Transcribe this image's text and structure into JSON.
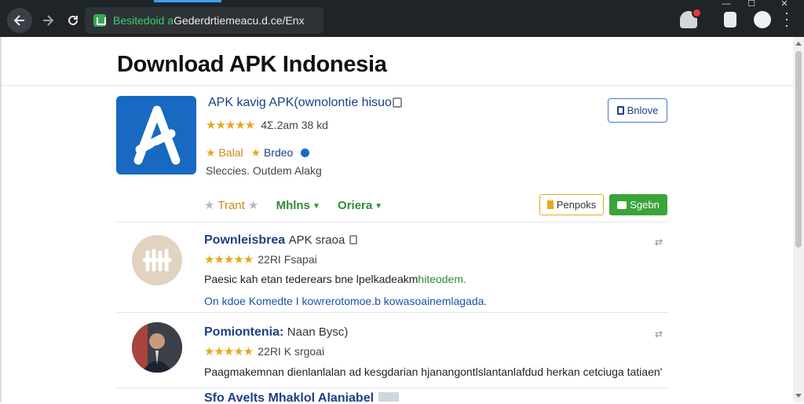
{
  "browser": {
    "url_host": "Besitedoid a",
    "url_path": "Gederdrtiemeacu.d.ce/Enx",
    "window_controls": [
      "—",
      "☐",
      "✕"
    ]
  },
  "page": {
    "title": "Download APK Indonesia"
  },
  "app": {
    "name": "APK kavig APK(ownolontie hisuo",
    "stars": "★★★★★",
    "meta": "4Σ.2am 38 kd",
    "tag1": "Balal",
    "tag2": "Brdeo",
    "categories": "Sleccies. Outdem Alakg",
    "follow_label": "Bnlove"
  },
  "filters": {
    "trending": "Trant",
    "mhins": "Mhlns",
    "oriera": "Oriera",
    "report_label": "Penpoks",
    "sign_label": "Sgebn"
  },
  "reviews": [
    {
      "name": "Pownleisbrea",
      "suffix": "APK sraoa",
      "stars": "★★★★★",
      "meta": "22RI Fsapai",
      "text_main": "Paesic kah etan tederears bne lpelkadeakm",
      "text_green": "hiteodem.",
      "link": "On kdoe Komedte I kowrerotomoe.b kowasoainemlagada."
    },
    {
      "name": "Pomiontenia:",
      "suffix": "Naan Bysc)",
      "stars": "★★★★★",
      "meta": "22RI K srgoai",
      "text_main": "Paagmakemnan dienlanlalan ad kesgdarian hjanangontlslantanlafdud herkan cetciuga tatiaen'"
    },
    {
      "name": "Sfo Avelts Mhaklol Alaniabel",
      "partial": true
    }
  ],
  "colors": {
    "brand_blue": "#1769c2",
    "link_blue": "#1c3f86",
    "star_gold": "#e8a81c",
    "action_green": "#3aa43a"
  }
}
